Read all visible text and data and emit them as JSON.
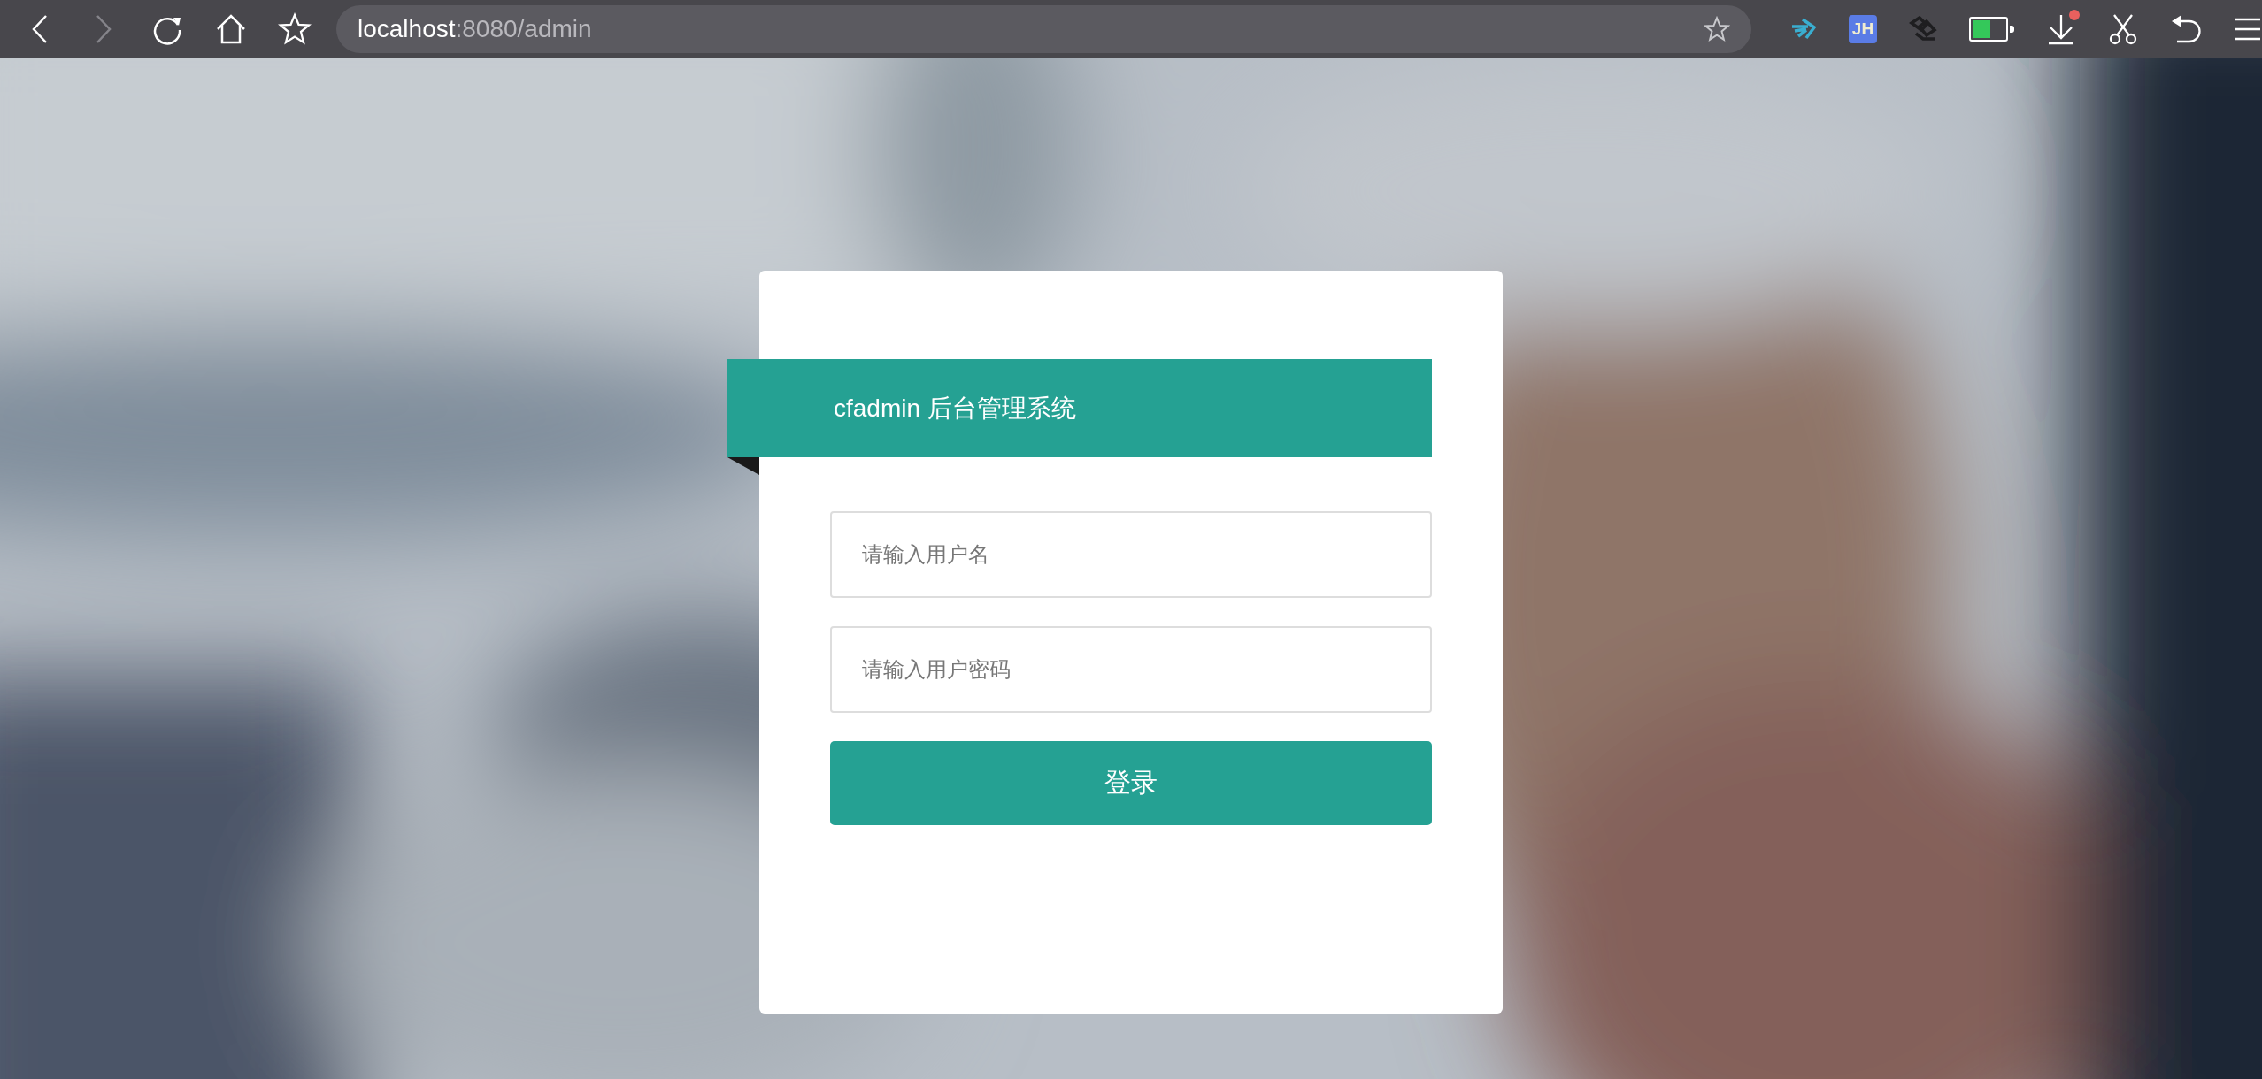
{
  "browser": {
    "nav_buttons": [
      {
        "kind": "back",
        "disabled": false
      },
      {
        "kind": "forward",
        "disabled": true
      },
      {
        "kind": "reload",
        "disabled": false
      },
      {
        "kind": "home",
        "disabled": false
      },
      {
        "kind": "bookmarks",
        "disabled": false
      }
    ],
    "address": {
      "host": "localhost",
      "path": ":8080/admin"
    },
    "extensions": [
      {
        "kind": "arrows"
      },
      {
        "kind": "badge",
        "label": "JH"
      },
      {
        "kind": "rings"
      },
      {
        "kind": "battery",
        "level": 0.55
      },
      {
        "kind": "download",
        "notification": true
      },
      {
        "kind": "scissors"
      },
      {
        "kind": "undo"
      },
      {
        "kind": "menu"
      }
    ]
  },
  "login": {
    "title": "cfadmin 后台管理系统",
    "fields": [
      {
        "placeholder": "请输入用户名"
      },
      {
        "placeholder": "请输入用户密码"
      }
    ],
    "submit": "登录"
  }
}
